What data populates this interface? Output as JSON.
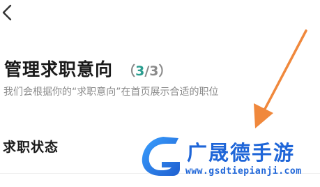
{
  "header": {
    "back_icon": "chevron-left-icon"
  },
  "main": {
    "title": "管理求职意向",
    "count_open": "（",
    "count_current": "3",
    "count_total": "/3）",
    "subtitle": "我们会根据你的“求职意向”在首页展示合适的职位",
    "status_label": "求职状态"
  },
  "annotation": {
    "arrow_color": "#f0883c"
  },
  "watermark": {
    "name": "广晟德手游",
    "url": "www.gsdtiepianji.com",
    "color": "#1f66d8"
  }
}
